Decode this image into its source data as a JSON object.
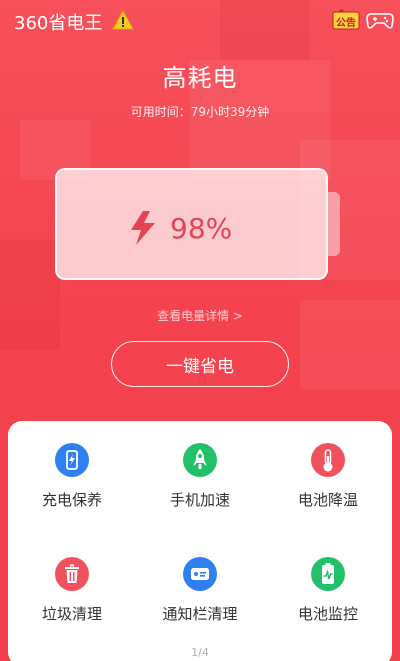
{
  "header": {
    "app_title": "360省电王",
    "notice_label": "公告"
  },
  "status": {
    "headline": "高耗电",
    "remain_time": "可用时间：79小时39分钟"
  },
  "battery": {
    "percent_text": "98%",
    "level": 0.98
  },
  "details_link": "查看电量详情 >",
  "save_button": "一键省电",
  "tools": [
    {
      "label": "充电保养",
      "icon": "phone-charge-icon",
      "color": "#2f7ff0"
    },
    {
      "label": "手机加速",
      "icon": "rocket-icon",
      "color": "#23c06a"
    },
    {
      "label": "电池降温",
      "icon": "thermometer-icon",
      "color": "#f0525d"
    },
    {
      "label": "垃圾清理",
      "icon": "trash-icon",
      "color": "#f0525d"
    },
    {
      "label": "通知栏清理",
      "icon": "notification-card-icon",
      "color": "#2f7ff0"
    },
    {
      "label": "电池监控",
      "icon": "battery-monitor-icon",
      "color": "#23c06a"
    }
  ],
  "pager": "1/4"
}
